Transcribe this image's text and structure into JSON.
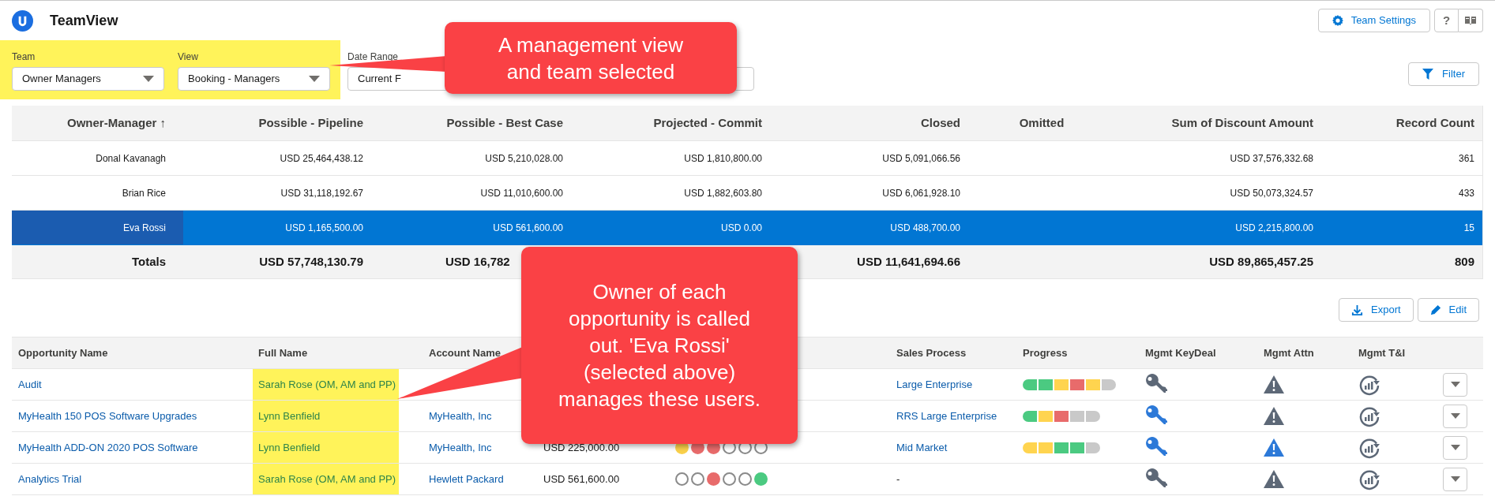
{
  "app": {
    "title": "TeamView"
  },
  "header_buttons": [
    {
      "kind": "settings",
      "label": "Team Settings"
    },
    {
      "kind": "help",
      "label": "?"
    },
    {
      "kind": "book"
    }
  ],
  "filters": [
    {
      "label": "Team",
      "value": "Owner Managers",
      "highlighted": true
    },
    {
      "label": "View",
      "value": "Booking - Managers",
      "highlighted": true
    },
    {
      "label": "Date Range",
      "value": "Current F",
      "highlighted": false
    }
  ],
  "filter_button": {
    "label": "Filter"
  },
  "summary_table": {
    "columns": [
      "Owner-Manager ↑",
      "Possible - Pipeline",
      "Possible - Best Case",
      "Projected - Commit",
      "Closed",
      "Omitted",
      "Sum of Discount Amount",
      "Record Count"
    ],
    "rows": [
      {
        "selected": false,
        "cells": [
          "Donal Kavanagh",
          "USD 25,464,438.12",
          "USD 5,210,028.00",
          "USD 1,810,800.00",
          "USD 5,091,066.56",
          null,
          "USD 37,576,332.68",
          "361"
        ]
      },
      {
        "selected": false,
        "cells": [
          "Brian Rice",
          "USD 31,118,192.67",
          "USD 11,010,600.00",
          "USD 1,882,603.80",
          "USD 6,061,928.10",
          null,
          "USD 50,073,324.57",
          "433"
        ]
      },
      {
        "selected": true,
        "cells": [
          "Eva Rossi",
          "USD 1,165,500.00",
          "USD 561,600.00",
          "USD 0.00",
          "USD 488,700.00",
          null,
          "USD 2,215,800.00",
          "15"
        ]
      }
    ],
    "totals": {
      "label": "Totals",
      "pipeline": "USD 57,748,130.79",
      "best_case": "USD 16,782",
      "closed": "USD 11,641,694.66",
      "discount": "USD 89,865,457.25",
      "count": "809"
    }
  },
  "table_buttons": [
    {
      "kind": "export",
      "label": "Export"
    },
    {
      "kind": "edit",
      "label": "Edit"
    }
  ],
  "opportunities": {
    "columns": [
      "Opportunity Name",
      "Full Name",
      "Account Name",
      null,
      null,
      "Sales Process",
      "Progress",
      "Mgmt KeyDeal",
      "Mgmt Attn",
      "Mgmt T&I"
    ],
    "rows": [
      {
        "name": "Audit",
        "full_name": "Sarah Rose (OM, AM and PP)",
        "highlighted": true,
        "sales_process": "Large Enterprise",
        "progress": [
          {
            "color": "#4bca81"
          },
          {
            "color": "#4bca81"
          },
          {
            "color": "#ffd44f"
          },
          {
            "color": "#e86b6b"
          },
          {
            "color": "#ffd44f"
          },
          {
            "color": "#c9c9c9"
          }
        ],
        "key_deal": false,
        "attention": false
      },
      {
        "name": "MyHealth 150 POS Software Upgrades",
        "full_name": "Lynn Benfield",
        "highlighted": true,
        "account": "MyHealth, Inc",
        "sales_process": "RRS Large Enterprise",
        "progress": [
          {
            "color": "#4bca81"
          },
          {
            "color": "#ffd44f"
          },
          {
            "color": "#e86b6b"
          },
          {
            "color": "#c9c9c9"
          },
          {
            "color": "#c9c9c9"
          }
        ],
        "key_deal": true,
        "attention": false
      },
      {
        "name": "MyHealth ADD-ON 2020 POS Software",
        "full_name": "Lynn Benfield",
        "highlighted": true,
        "account": "MyHealth, Inc",
        "amount": "USD 225,000.00",
        "dots": [
          {
            "filled": true,
            "color": "#f9d04a"
          },
          {
            "filled": true,
            "color": "#e86b6b"
          },
          {
            "filled": true,
            "color": "#e86b6b"
          },
          {
            "filled": false
          },
          {
            "filled": false
          },
          {
            "filled": false
          }
        ],
        "sales_process": "Mid Market",
        "progress": [
          {
            "color": "#ffd44f"
          },
          {
            "color": "#ffd44f"
          },
          {
            "color": "#4bca81"
          },
          {
            "color": "#4bca81"
          },
          {
            "color": "#c9c9c9"
          }
        ],
        "key_deal": true,
        "attention": true
      },
      {
        "name": "Analytics Trial",
        "full_name": "Sarah Rose (OM, AM and PP)",
        "highlighted": true,
        "account": "Hewlett Packard",
        "amount": "USD 561,600.00",
        "dots": [
          {
            "filled": false
          },
          {
            "filled": false
          },
          {
            "filled": true,
            "color": "#e86b6b"
          },
          {
            "filled": false
          },
          {
            "filled": false
          },
          {
            "filled": true,
            "color": "#4bca81"
          }
        ],
        "sales_process": "-",
        "key_deal": false,
        "attention": false
      }
    ]
  },
  "callouts": [
    {
      "text": "A management view and team selected"
    },
    {
      "text": "Owner of each opportunity is called out. 'Eva Rossi' (selected above) manages these users."
    }
  ]
}
